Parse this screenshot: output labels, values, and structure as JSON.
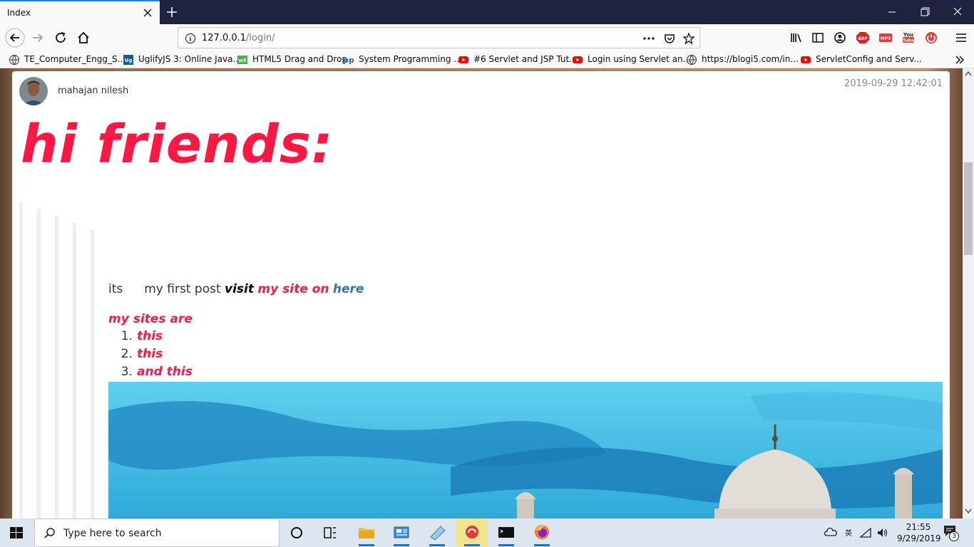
{
  "browser": {
    "tab_title": "Index",
    "url_host": "127.0.0.1",
    "url_path": "/login/"
  },
  "bookmarks": [
    {
      "label": "TE_Computer_Engg_S...",
      "icon": "globe-icon"
    },
    {
      "label": "UglifyJS 3: Online Java...",
      "icon": "uglify-icon"
    },
    {
      "label": "HTML5 Drag and Drop",
      "icon": "w3-icon"
    },
    {
      "label": "System Programming ...",
      "icon": "pp-icon"
    },
    {
      "label": "#6 Servlet and JSP Tut...",
      "icon": "youtube-icon"
    },
    {
      "label": "Login using Servlet an...",
      "icon": "youtube-icon"
    },
    {
      "label": "https://blogi5.com/in...",
      "icon": "globe-icon"
    },
    {
      "label": "ServletConfig and Serv...",
      "icon": "youtube-icon"
    }
  ],
  "post": {
    "author": "mahajan nilesh",
    "timestamp": "2019-09-29 12:42:01",
    "headline": "hi friends:",
    "line_its": "its",
    "line_plain": "my first post",
    "line_visit": "visit",
    "line_red": "my site on",
    "line_link": "here",
    "sites_title": "my sites are",
    "sites": [
      {
        "num": "1.",
        "label": "this"
      },
      {
        "num": "2.",
        "label": "this"
      },
      {
        "num": "3.",
        "label": "and this"
      }
    ]
  },
  "taskbar": {
    "search_placeholder": "Type here to search",
    "time": "21:55",
    "date": "9/29/2019",
    "notifications": "3"
  },
  "colors": {
    "accent_red": "#ff1744",
    "link_blue": "#3a6fb0",
    "tab_strip": "#202340"
  }
}
